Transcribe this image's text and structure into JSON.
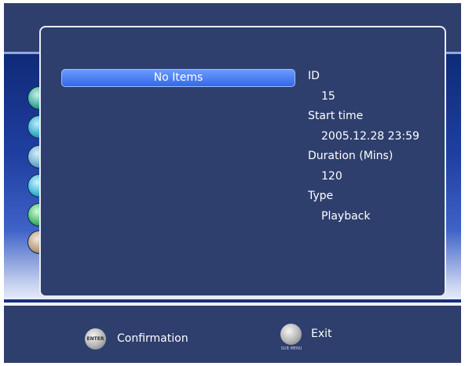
{
  "list": {
    "empty_label": "No Items"
  },
  "details": [
    {
      "label": "ID",
      "value": "15"
    },
    {
      "label": "Start time",
      "value": "2005.12.28 23:59"
    },
    {
      "label": "Duration (Mins)",
      "value": "120"
    },
    {
      "label": "Type",
      "value": "Playback"
    }
  ],
  "footer": {
    "confirm_key": "ENTER",
    "confirm_label": "Confirmation",
    "exit_key": "SUB MENU",
    "exit_label": "Exit"
  }
}
